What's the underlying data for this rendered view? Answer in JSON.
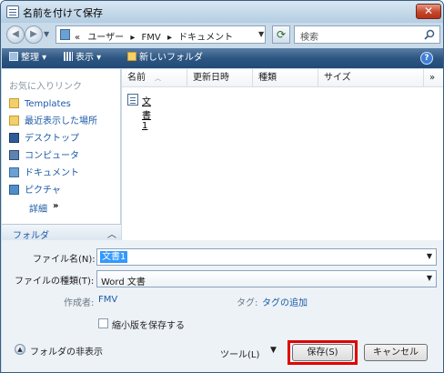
{
  "window": {
    "title": "名前を付けて保存",
    "close_label": "✕"
  },
  "address": {
    "path_prefix": "«",
    "crumbs": [
      "ユーザー",
      "FMV",
      "ドキュメント"
    ],
    "separator": "▸",
    "search_placeholder": "検索"
  },
  "toolbar": {
    "organize": "整理",
    "views": "表示",
    "new_folder": "新しいフォルダ",
    "help": "?"
  },
  "sidebar": {
    "favorites_header": "お気に入りリンク",
    "items": [
      {
        "label": "Templates",
        "icon": "template-folder-icon"
      },
      {
        "label": "最近表示した場所",
        "icon": "recent-places-icon"
      },
      {
        "label": "デスクトップ",
        "icon": "desktop-icon"
      },
      {
        "label": "コンピュータ",
        "icon": "computer-icon"
      },
      {
        "label": "ドキュメント",
        "icon": "documents-icon"
      },
      {
        "label": "ピクチャ",
        "icon": "pictures-icon"
      }
    ],
    "details_label": "詳細",
    "details_chevron": "»",
    "folders_label": "フォルダ",
    "folders_chevron": "︿"
  },
  "filelist": {
    "columns": [
      "名前",
      "更新日時",
      "種類",
      "サイズ"
    ],
    "more": "»",
    "files": [
      {
        "name": "文書1"
      }
    ]
  },
  "form": {
    "filename_label": "ファイル名(N):",
    "filename_value": "文書1",
    "filetype_label": "ファイルの種類(T):",
    "filetype_value": "Word 文書",
    "author_label": "作成者:",
    "author_value": "FMV",
    "tags_label": "タグ:",
    "tags_value": "タグの追加",
    "thumbnail_label": "縮小版を保存する",
    "thumbnail_checked": false
  },
  "footer": {
    "hide_folders": "フォルダの非表示",
    "tools": "ツール(L)",
    "save": "保存(S)",
    "cancel": "キャンセル"
  },
  "colors": {
    "highlight": "#e00000",
    "link": "#1c5aa7",
    "toolbar": "#2d5682"
  }
}
